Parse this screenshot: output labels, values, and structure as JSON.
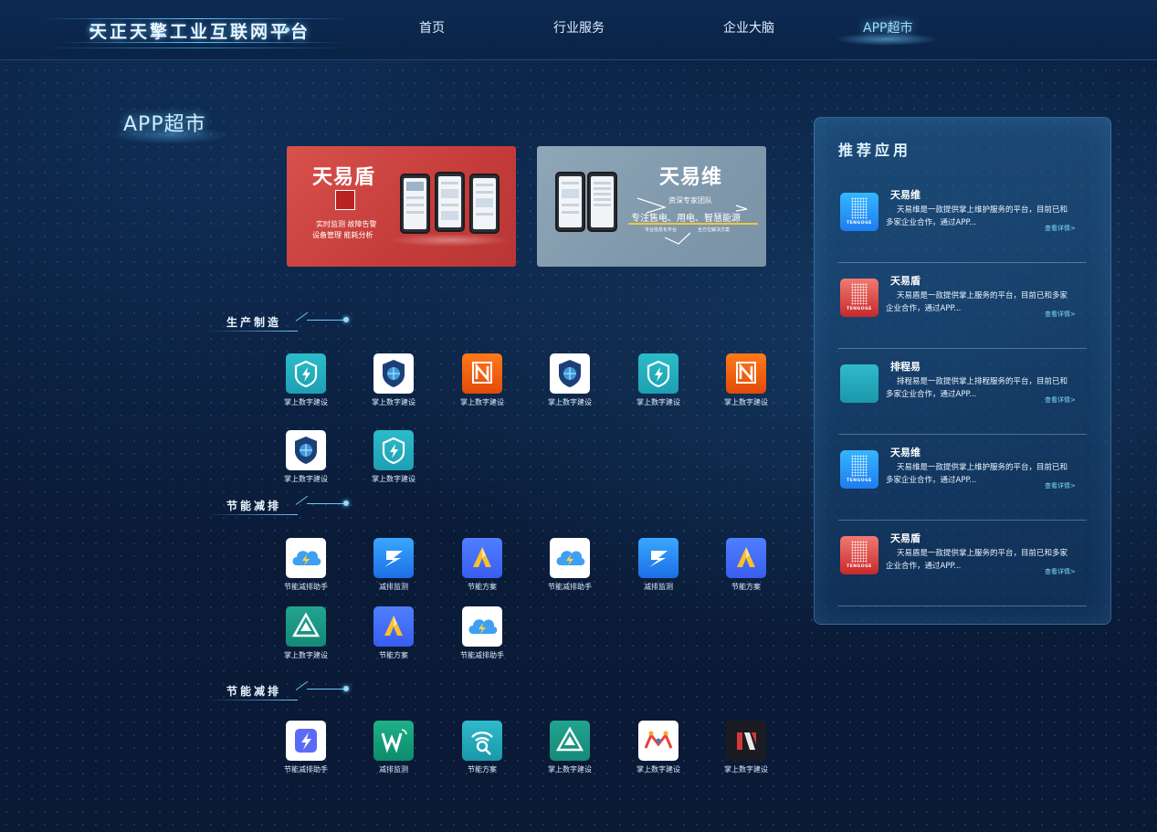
{
  "header": {
    "logo_title": "天正天擎工业互联网平台",
    "nav": [
      {
        "label": "首页",
        "active": false
      },
      {
        "label": "行业服务",
        "active": false
      },
      {
        "label": "企业大脑",
        "active": false
      },
      {
        "label": "APP超市",
        "active": true
      }
    ]
  },
  "page_title": "APP超市",
  "banners": {
    "left": {
      "title": "天易盾",
      "line1": "实时监测 故障告警",
      "line2": "设备管理 能耗分析"
    },
    "right": {
      "title": "天易维",
      "team": "资深专家团队",
      "slogan": "专注售电、用电、智慧能源",
      "foot1": "专业信息化平台",
      "foot2": "全方位解决方案"
    }
  },
  "sections": [
    {
      "title": "生产制造",
      "apps": [
        {
          "name": "掌上数字建设",
          "icon": "lightning-shield-icon"
        },
        {
          "name": "掌上数字建设",
          "icon": "globe-shield-icon"
        },
        {
          "name": "掌上数字建设",
          "icon": "n-logo-icon"
        },
        {
          "name": "掌上数字建设",
          "icon": "globe-shield-icon"
        },
        {
          "name": "掌上数字建设",
          "icon": "lightning-shield-icon"
        },
        {
          "name": "掌上数字建设",
          "icon": "n-logo-icon"
        },
        {
          "name": "掌上数字建设",
          "icon": "globe-shield-icon"
        },
        {
          "name": "掌上数字建设",
          "icon": "lightning-shield-icon"
        }
      ]
    },
    {
      "title": "节能减排",
      "apps": [
        {
          "name": "节能减排助手",
          "icon": "cloud-lightning-icon"
        },
        {
          "name": "减排监测",
          "icon": "s-bolt-icon"
        },
        {
          "name": "节能方案",
          "icon": "a-logo-icon"
        },
        {
          "name": "节能减排助手",
          "icon": "cloud-lightning-icon"
        },
        {
          "name": "减排监测",
          "icon": "s-bolt-icon"
        },
        {
          "name": "节能方案",
          "icon": "a-logo-icon"
        },
        {
          "name": "掌上数字建设",
          "icon": "triangle-map-icon"
        },
        {
          "name": "节能方案",
          "icon": "a-logo-icon"
        },
        {
          "name": "节能减排助手",
          "icon": "cloud-lightning-icon"
        }
      ]
    },
    {
      "title": "节能减排",
      "apps": [
        {
          "name": "节能减排助手",
          "icon": "bolt-shield-icon"
        },
        {
          "name": "减排监测",
          "icon": "w-signal-icon"
        },
        {
          "name": "节能方案",
          "icon": "signal-search-icon"
        },
        {
          "name": "掌上数字建设",
          "icon": "triangle-map-icon"
        },
        {
          "name": "掌上数字建设",
          "icon": "m-people-icon"
        },
        {
          "name": "掌上数字建设",
          "icon": "m-red-logo-icon"
        }
      ]
    }
  ],
  "recommend": {
    "title": "推荐应用",
    "more_label": "查看详情>",
    "items": [
      {
        "name": "天易维",
        "icon": "tengoge-blue-icon",
        "brand": "TENGOGE",
        "desc": "天易维是一款提供掌上维护服务的平台，目前已和多家企业合作，通过APP..."
      },
      {
        "name": "天易盾",
        "icon": "tengoge-red-icon",
        "brand": "TENGOGE",
        "desc": "天易盾是一款提供掌上服务的平台，目前已和多家企业合作，通过APP..."
      },
      {
        "name": "排程易",
        "icon": "signal-search-icon",
        "brand": "",
        "desc": "排程易是一款提供掌上排程服务的平台，目前已和多家企业合作，通过APP..."
      },
      {
        "name": "天易维",
        "icon": "tengoge-blue-icon",
        "brand": "TENGOGE",
        "desc": "天易维是一款提供掌上维护服务的平台，目前已和多家企业合作，通过APP..."
      },
      {
        "name": "天易盾",
        "icon": "tengoge-red-icon",
        "brand": "TENGOGE",
        "desc": "天易盾是一款提供掌上服务的平台，目前已和多家企业合作，通过APP..."
      }
    ]
  }
}
